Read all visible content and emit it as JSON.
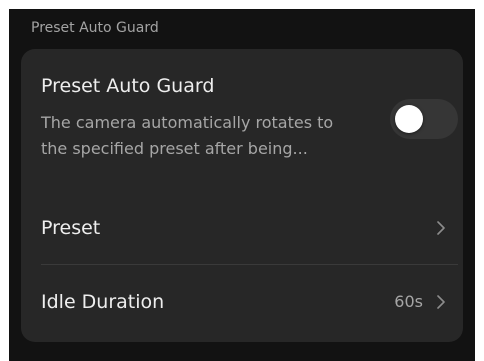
{
  "section": {
    "title": "Preset Auto Guard"
  },
  "auto_guard": {
    "title": "Preset Auto Guard",
    "description_line1": "The camera automatically rotates to",
    "description_line2": "the specified preset after being...",
    "enabled": false
  },
  "preset": {
    "label": "Preset",
    "icon": "chevron-right-icon"
  },
  "idle_duration": {
    "label": "Idle Duration",
    "value": "60s",
    "icon": "chevron-right-icon"
  },
  "colors": {
    "background": "#121212",
    "card": "#272727",
    "primary_text": "#eeeeee",
    "secondary_text": "#a6a6a6",
    "toggle_track_off": "#363636",
    "toggle_knob": "#ffffff"
  }
}
